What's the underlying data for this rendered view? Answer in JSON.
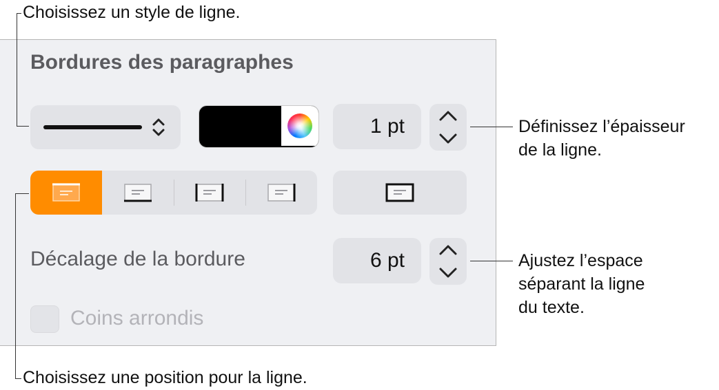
{
  "callouts": {
    "line_style": "Choisissez un style de ligne.",
    "thickness_line1": "Définissez l’épaisseur",
    "thickness_line2": "de la ligne.",
    "spacing_line1": "Ajustez l’espace",
    "spacing_line2": "séparant la ligne",
    "spacing_line3": "du texte.",
    "position": "Choisissez une position pour la ligne."
  },
  "panel": {
    "title": "Bordures des paragraphes",
    "border_color": "#000000",
    "accent_color": "#ff8c00",
    "thickness_value": "1 pt",
    "offset_label": "Décalage de la bordure",
    "offset_value": "6 pt",
    "rounded_corners_label": "Coins arrondis",
    "rounded_corners_checked": false,
    "position_options": [
      "top",
      "bottom",
      "left-right",
      "right",
      "box"
    ],
    "selected_position": "top"
  },
  "icons": {
    "line_style_popup": "up-down-chevron-icon",
    "color_picker": "color-wheel-icon",
    "stepper_up": "chevron-up-icon",
    "stepper_down": "chevron-down-icon"
  }
}
